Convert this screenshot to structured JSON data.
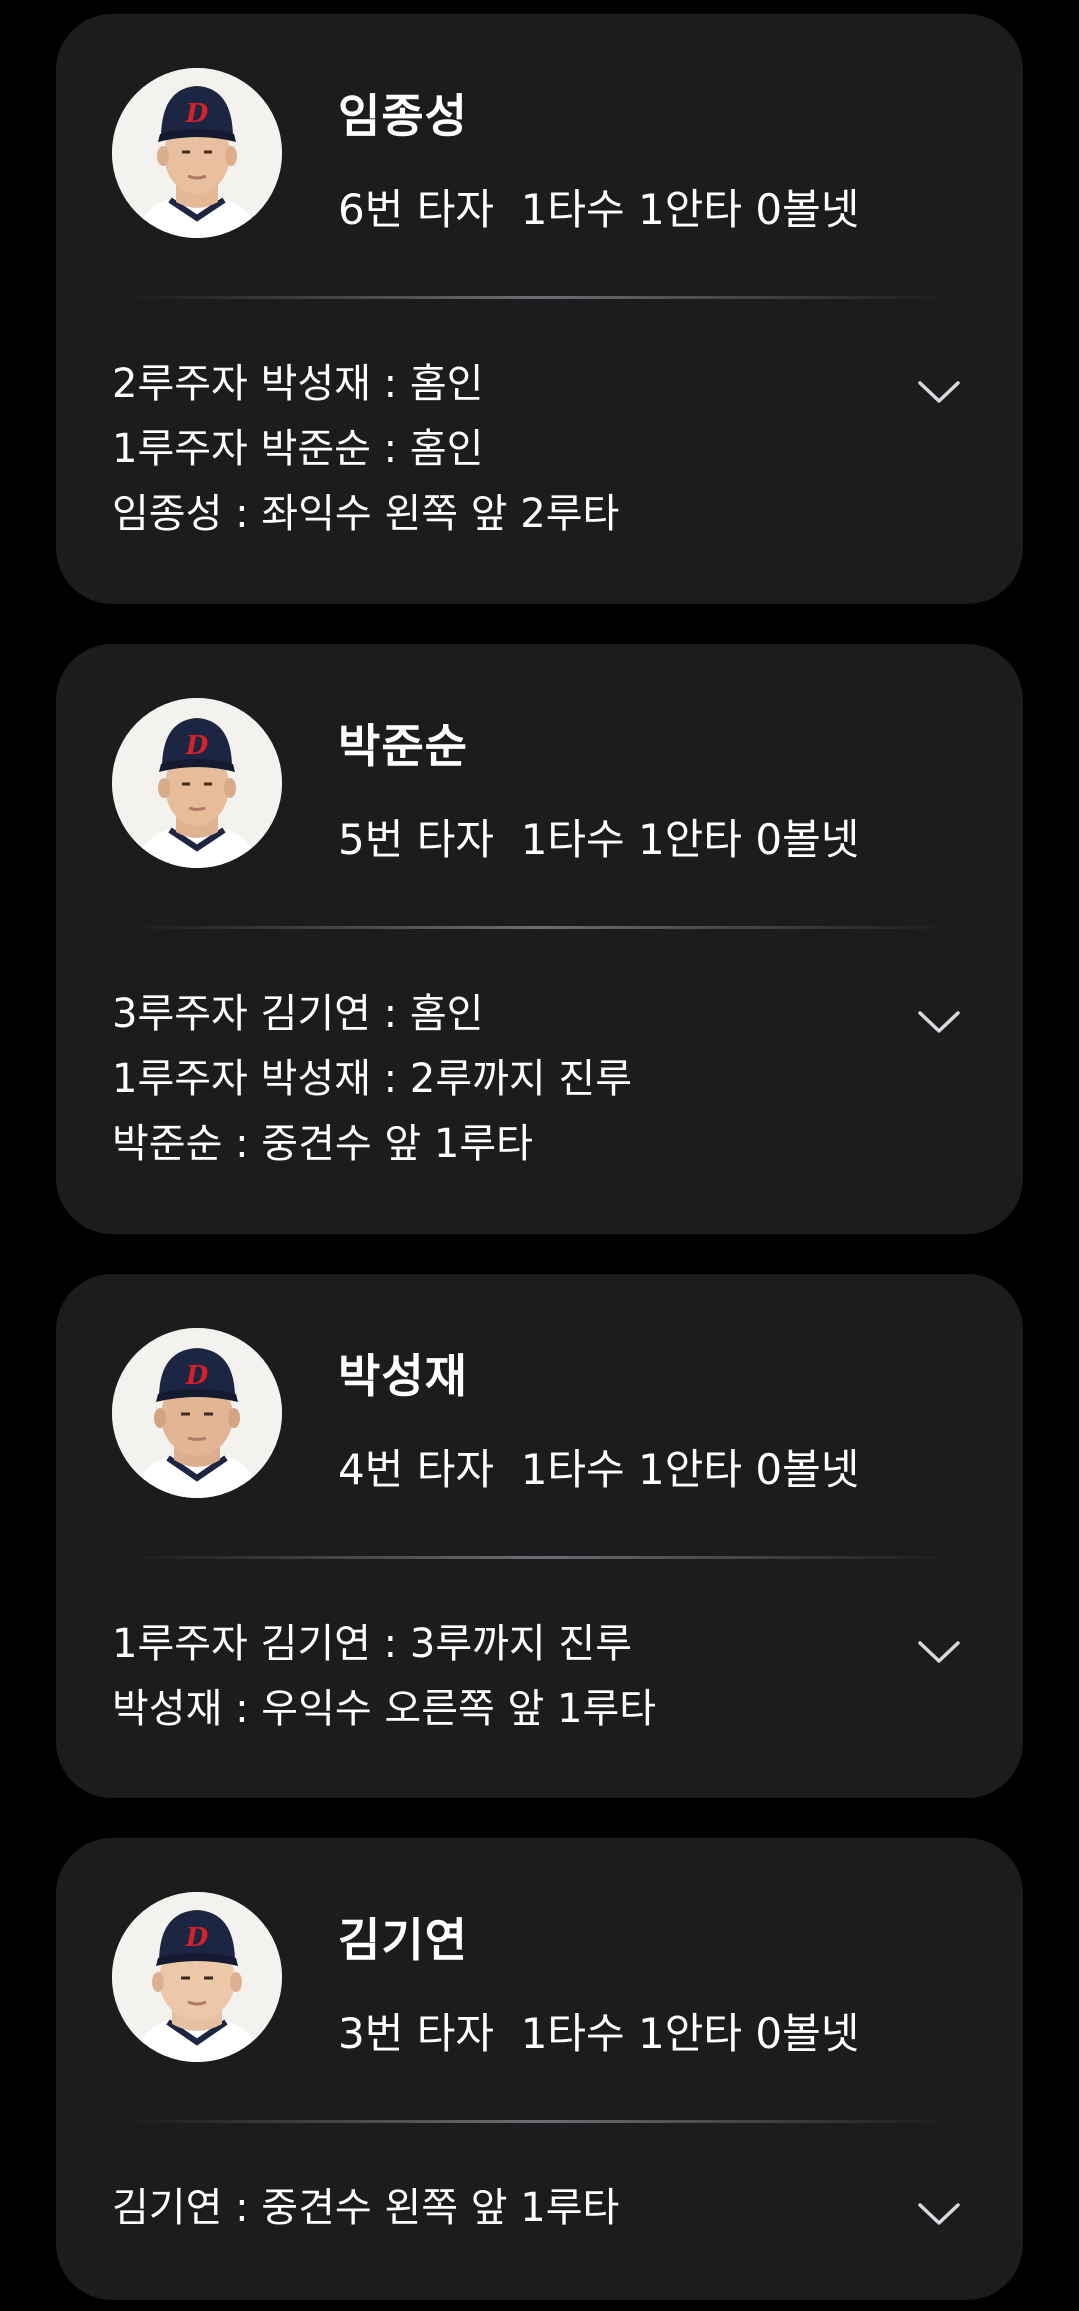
{
  "batters": [
    {
      "name": "임종성",
      "stats": "6번 타자  1타수 1안타 0볼넷",
      "plays": [
        "2루주자 박성재 : 홈인",
        "1루주자 박준순 : 홈인",
        "임종성 : 좌익수 왼쪽 앞 2루타"
      ],
      "expand_icon": "chevron-down-icon"
    },
    {
      "name": "박준순",
      "stats": "5번 타자  1타수 1안타 0볼넷",
      "plays": [
        "3루주자 김기연 : 홈인",
        "1루주자 박성재 : 2루까지 진루",
        "박준순 : 중견수 앞 1루타"
      ],
      "expand_icon": "chevron-down-icon"
    },
    {
      "name": "박성재",
      "stats": "4번 타자  1타수 1안타 0볼넷",
      "plays": [
        "1루주자 김기연 : 3루까지 진루",
        "박성재 : 우익수 오른쪽 앞 1루타"
      ],
      "expand_icon": "chevron-down-icon"
    },
    {
      "name": "김기연",
      "stats": "3번 타자  1타수 1안타 0볼넷",
      "plays": [
        "김기연 : 중견수 왼쪽 앞 1루타"
      ],
      "expand_icon": "chevron-down-icon"
    }
  ],
  "colors": {
    "background": "#000000",
    "card": "#1c1c1e",
    "text": "#ffffff",
    "divider": "#6e6e72",
    "cap_navy": "#1c2541",
    "cap_red": "#d6202a"
  }
}
